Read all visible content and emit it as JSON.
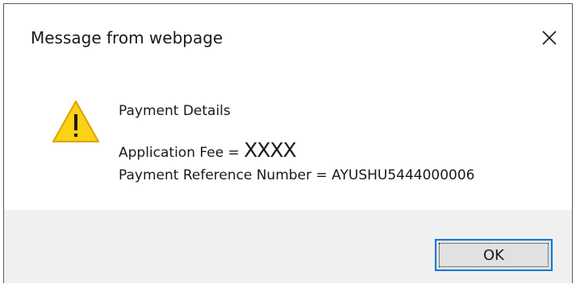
{
  "dialog": {
    "title": "Message from webpage",
    "close_icon": "close-icon",
    "warning_icon": "warning-icon",
    "heading": "Payment Details",
    "fee_label": "Application Fee = ",
    "fee_value": "XXXX",
    "reference_text": "Payment Reference Number = AYUSHU5444000006",
    "ok_label": "OK"
  },
  "colors": {
    "warning_fill": "#fcd116",
    "warning_stroke": "#d9a300",
    "button_focus_border": "#0078d7",
    "footer_background": "#f0f0f0",
    "button_background": "#e1e1e1"
  }
}
